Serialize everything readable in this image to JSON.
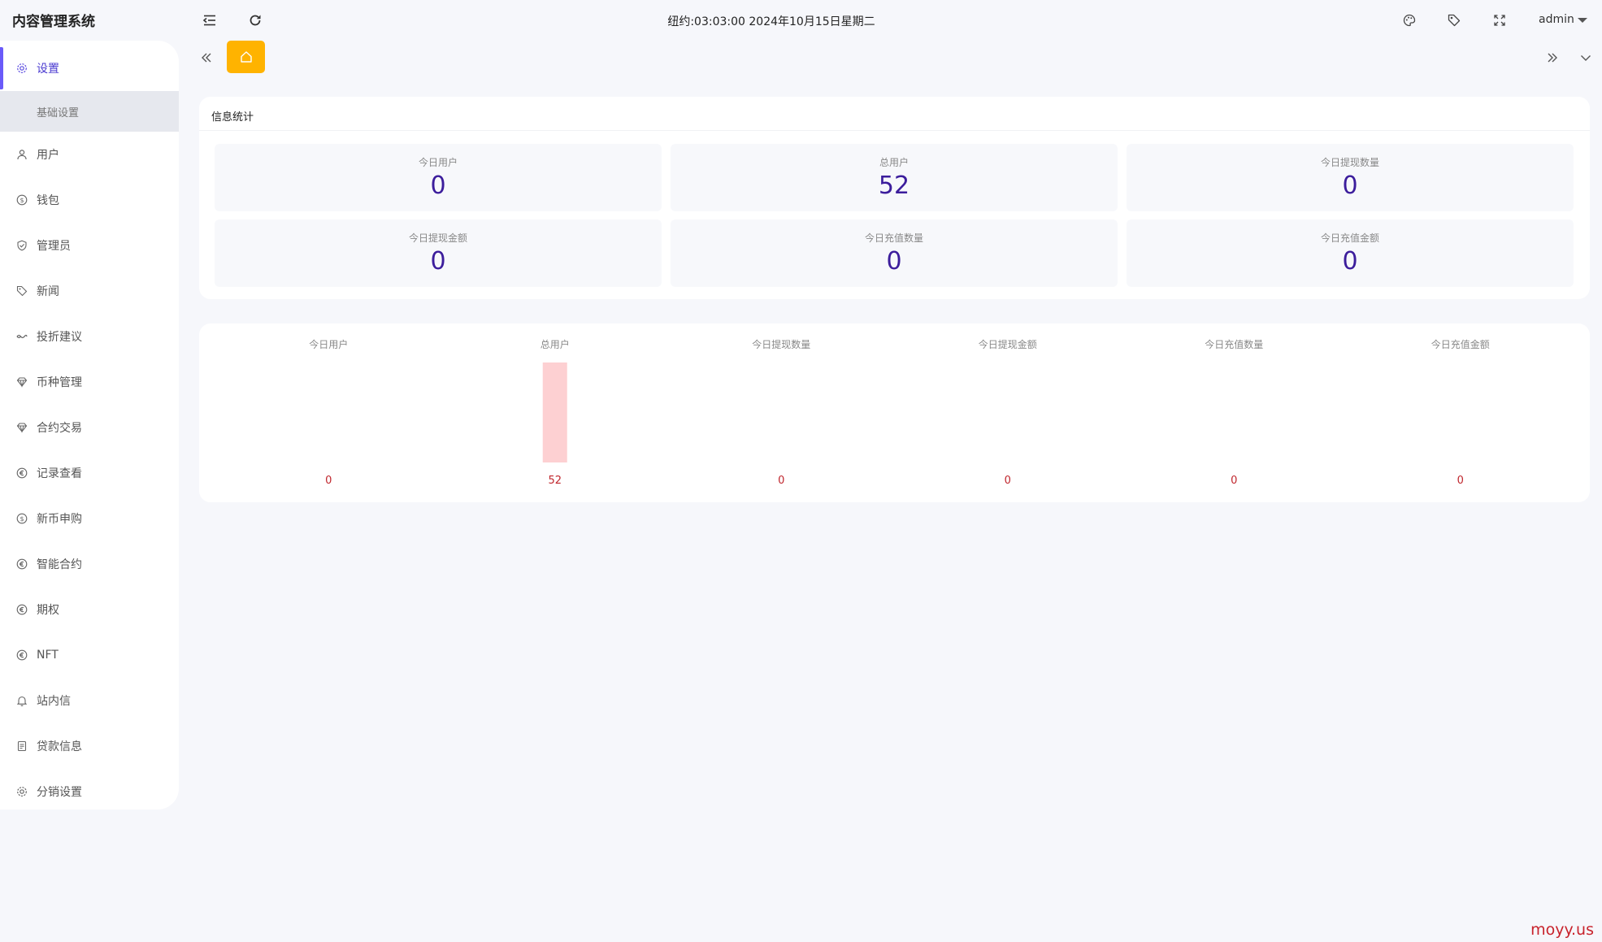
{
  "app": {
    "title": "内容管理系统"
  },
  "header": {
    "clock": "纽约:03:03:00 2024年10月15日星期二",
    "user": "admin"
  },
  "sidebar": {
    "items": [
      {
        "label": "设置",
        "icon": "gear-icon",
        "active": true,
        "children": [
          {
            "label": "基础设置"
          }
        ]
      },
      {
        "label": "用户",
        "icon": "user-icon"
      },
      {
        "label": "钱包",
        "icon": "coin-icon"
      },
      {
        "label": "管理员",
        "icon": "shield-icon"
      },
      {
        "label": "新闻",
        "icon": "tag-icon"
      },
      {
        "label": "投折建议",
        "icon": "handshake-icon"
      },
      {
        "label": "币种管理",
        "icon": "diamond-icon"
      },
      {
        "label": "合约交易",
        "icon": "diamond-icon"
      },
      {
        "label": "记录查看",
        "icon": "euro-circle-icon"
      },
      {
        "label": "新币申购",
        "icon": "coin-icon"
      },
      {
        "label": "智能合约",
        "icon": "euro-circle-icon"
      },
      {
        "label": "期权",
        "icon": "euro-circle-icon"
      },
      {
        "label": "NFT",
        "icon": "euro-circle-icon"
      },
      {
        "label": "站内信",
        "icon": "bell-icon"
      },
      {
        "label": "贷款信息",
        "icon": "document-icon"
      },
      {
        "label": "分销设置",
        "icon": "gear-icon"
      }
    ]
  },
  "stats": {
    "title": "信息统计",
    "items": [
      {
        "label": "今日用户",
        "value": "0"
      },
      {
        "label": "总用户",
        "value": "52"
      },
      {
        "label": "今日提现数量",
        "value": "0"
      },
      {
        "label": "今日提现金额",
        "value": "0"
      },
      {
        "label": "今日充值数量",
        "value": "0"
      },
      {
        "label": "今日充值金额",
        "value": "0"
      }
    ]
  },
  "chart_data": {
    "type": "bar",
    "categories": [
      "今日用户",
      "总用户",
      "今日提现数量",
      "今日提现金额",
      "今日充值数量",
      "今日充值金额"
    ],
    "values": [
      0,
      52,
      0,
      0,
      0,
      0
    ],
    "bar_color": "#fdd0d2",
    "label_color": "#c0262d",
    "title": "",
    "xlabel": "",
    "ylabel": "",
    "ylim": [
      0,
      52
    ],
    "grid": false
  },
  "watermark": "moyy.us"
}
